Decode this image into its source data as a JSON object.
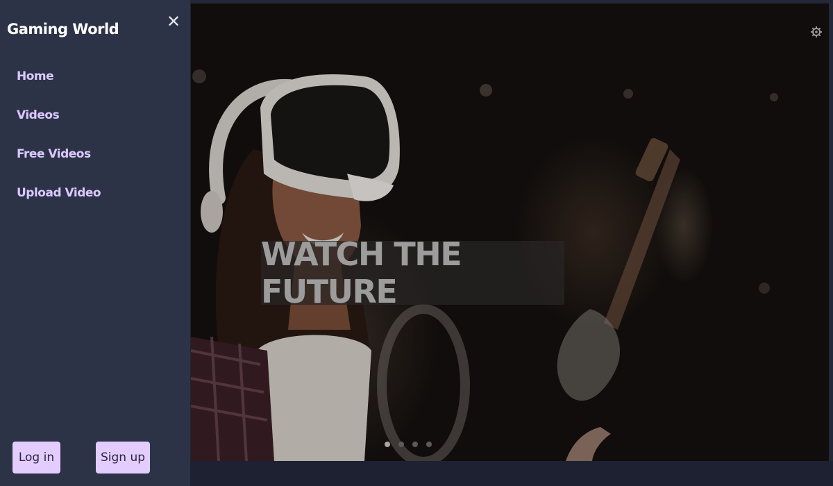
{
  "sidebar": {
    "brand": "Gaming World",
    "close_symbol": "✕",
    "items": [
      {
        "label": "Home"
      },
      {
        "label": "Videos"
      },
      {
        "label": "Free Videos"
      },
      {
        "label": "Upload Video"
      }
    ],
    "login_label": "Log in",
    "signup_label": "Sign up"
  },
  "hero": {
    "headline": "WATCH THE FUTURE",
    "settings_icon": "gear-icon",
    "carousel": {
      "slides": 4,
      "active_index": 0
    }
  },
  "colors": {
    "sidebar_bg": "#2c3347",
    "nav_text": "#dcc8ff",
    "button_bg": "#e3cdfe",
    "page_bg": "#1f2433"
  }
}
